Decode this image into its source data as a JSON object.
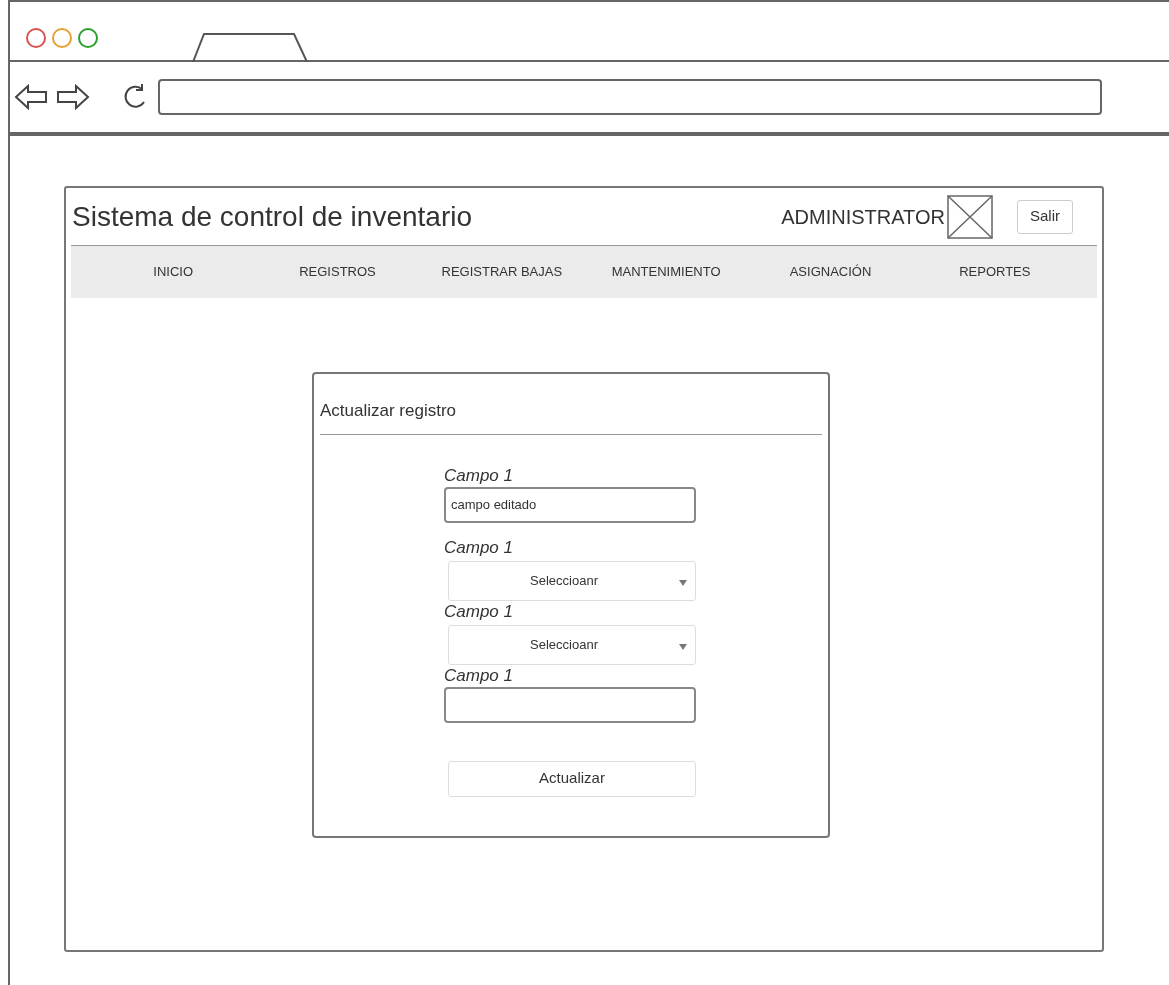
{
  "app": {
    "title": "Sistema de control de inventario",
    "user": "ADMINISTRATOR",
    "logout": "Salir"
  },
  "nav": [
    {
      "label": "INICIO"
    },
    {
      "label": "REGISTROS"
    },
    {
      "label": "REGISTRAR BAJAS"
    },
    {
      "label": "MANTENIMIENTO"
    },
    {
      "label": "ASIGNACIÓN"
    },
    {
      "label": "REPORTES"
    }
  ],
  "form": {
    "title": "Actualizar registro",
    "fields": [
      {
        "kind": "text",
        "label": "Campo 1",
        "value": "campo editado"
      },
      {
        "kind": "select",
        "label": "Campo 1",
        "value": "Seleccioanr"
      },
      {
        "kind": "select",
        "label": "Campo 1",
        "value": "Seleccioanr"
      },
      {
        "kind": "text",
        "label": "Campo 1"
      }
    ],
    "submit": "Actualizar"
  }
}
